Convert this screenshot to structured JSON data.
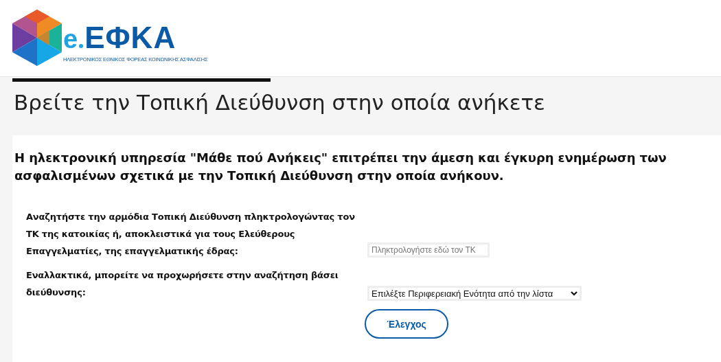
{
  "header": {
    "logo_e": "e",
    "logo_name": "ΕΦΚΑ",
    "logo_tagline": "ΗΛΕΚΤΡΟΝΙΚΟΣ ΕΘΝΙΚΟΣ ΦΟΡΕΑΣ ΚΟΙΝΩΝΙΚΗΣ ΑΣΦΑΛΙΣΗΣ"
  },
  "page_title": "Βρείτε την Τοπική Διεύθυνση στην οποία ανήκετε",
  "intro": "Η ηλεκτρονική υπηρεσία \"Μάθε πού Ανήκεις\" επιτρέπει την άμεση και έγκυρη ενημέρωση των ασφαλισμένων σχετικά με την Τοπική Διεύθυνση στην οποία ανήκουν.",
  "form": {
    "postcode_label": "Αναζητήστε την αρμόδια Τοπική Διεύθυνση πληκτρολογώντας τον ΤΚ της κατοικίας ή, αποκλειστικά για τους Ελεύθερους Επαγγελματίες, της επαγγελματικής έδρας:",
    "postcode_placeholder": "Πληκτρολογήστε εδώ τον ΤΚ",
    "address_label": "Εναλλακτικά, μπορείτε να προχωρήσετε στην αναζήτηση βάσει διεύθυνσης:",
    "region_select": "Επιλέξτε Περιφερειακή Ενότητα από την λίστα",
    "check_button": "Έλεγχος"
  }
}
